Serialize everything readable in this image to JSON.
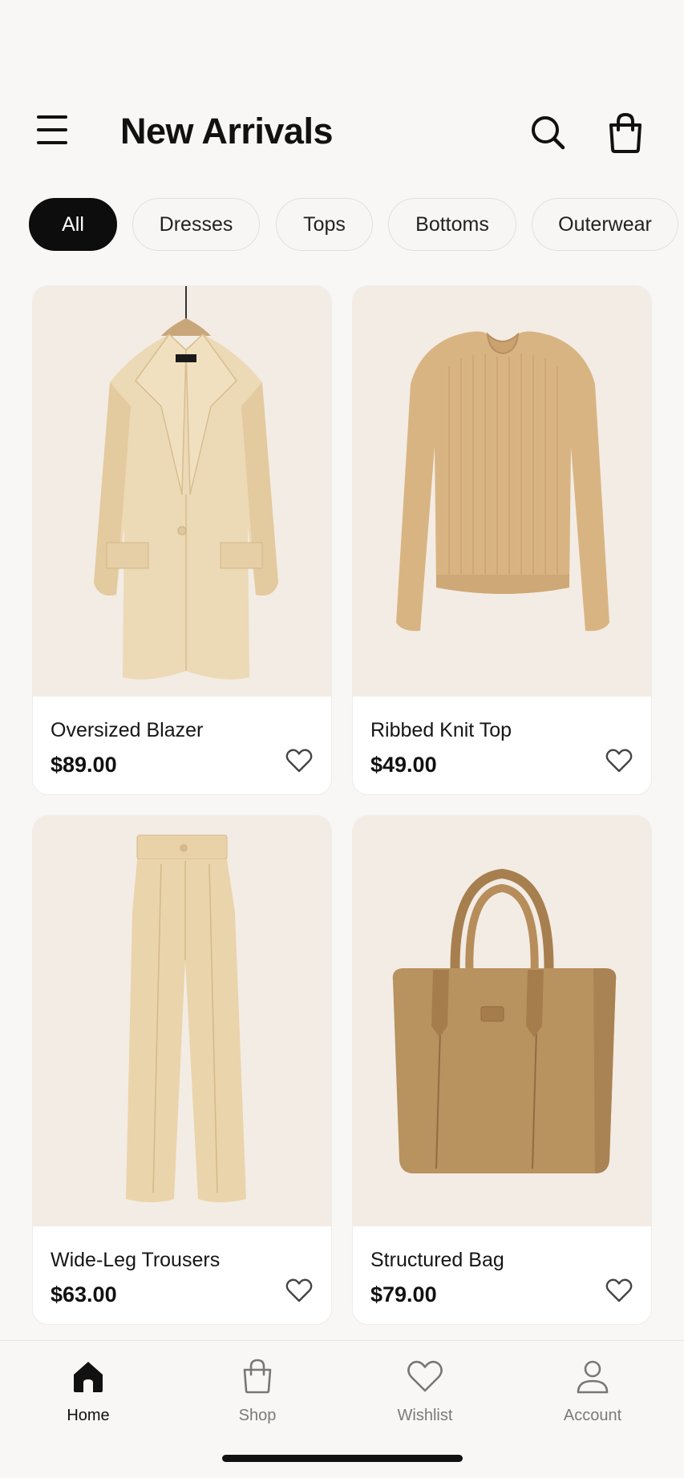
{
  "header": {
    "title": "New Arrivals",
    "menu_icon": "hamburger-menu-icon",
    "search_icon": "search-icon",
    "cart_icon": "shopping-bag-icon"
  },
  "filters": [
    {
      "label": "All",
      "active": true
    },
    {
      "label": "Dresses",
      "active": false
    },
    {
      "label": "Tops",
      "active": false
    },
    {
      "label": "Bottoms",
      "active": false
    },
    {
      "label": "Outerwear",
      "active": false
    }
  ],
  "products": [
    {
      "name": "Oversized Blazer",
      "price": "$89.00",
      "image": "beige-blazer-on-hanger"
    },
    {
      "name": "Ribbed Knit Top",
      "price": "$49.00",
      "image": "tan-ribbed-sweater"
    },
    {
      "name": "Wide-Leg Trousers",
      "price": "$63.00",
      "image": "beige-wide-leg-trousers"
    },
    {
      "name": "Structured Bag",
      "price": "$79.00",
      "image": "tan-leather-tote-bag"
    }
  ],
  "bottom_nav": [
    {
      "label": "Home",
      "icon": "home-icon",
      "active": true
    },
    {
      "label": "Shop",
      "icon": "shopping-bag-icon",
      "active": false
    },
    {
      "label": "Wishlist",
      "icon": "heart-icon",
      "active": false
    },
    {
      "label": "Account",
      "icon": "user-icon",
      "active": false
    }
  ],
  "colors": {
    "background": "#f8f7f6",
    "accent": "#0d0d0d",
    "image_bg": "#f3ece4",
    "product_beige": "#e8d3ad",
    "product_tan": "#d9b483",
    "bag_brown": "#b8925f"
  }
}
